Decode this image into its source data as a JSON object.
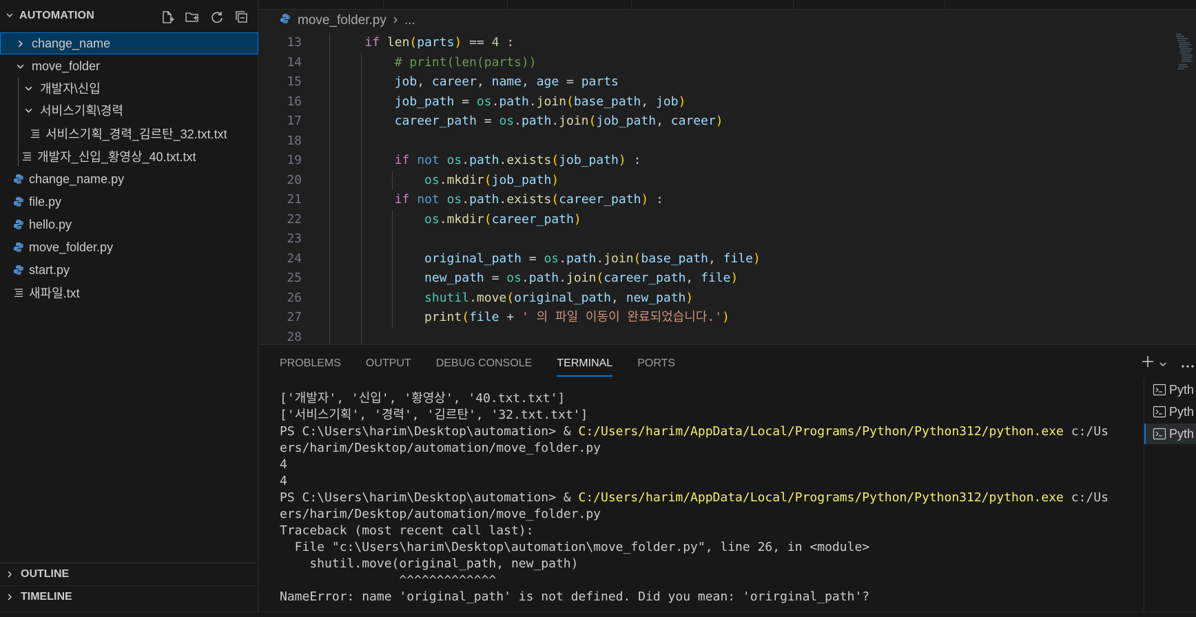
{
  "explorer": {
    "title": "AUTOMATION",
    "actions": [
      "new-file-icon",
      "new-folder-icon",
      "refresh-icon",
      "collapse-all-icon"
    ],
    "items": [
      {
        "label": "change_name",
        "type": "folder",
        "state": "collapsed"
      },
      {
        "label": "move_folder",
        "type": "folder",
        "state": "expanded"
      },
      {
        "label": "개발자\\신입",
        "type": "folder",
        "state": "expanded"
      },
      {
        "label": "서비스기획\\경력",
        "type": "folder",
        "state": "expanded"
      },
      {
        "label": "서비스기획_경력_김르탄_32.txt.txt",
        "type": "text"
      },
      {
        "label": "개발자_신입_황영상_40.txt.txt",
        "type": "text"
      },
      {
        "label": "change_name.py",
        "type": "python"
      },
      {
        "label": "file.py",
        "type": "python"
      },
      {
        "label": "hello.py",
        "type": "python"
      },
      {
        "label": "move_folder.py",
        "type": "python"
      },
      {
        "label": "start.py",
        "type": "python"
      },
      {
        "label": "새파일.txt",
        "type": "text"
      }
    ],
    "outline_label": "OUTLINE",
    "timeline_label": "TIMELINE"
  },
  "editor": {
    "breadcrumb_file": "move_folder.py",
    "breadcrumb_rest": "...",
    "line_numbers": [
      "13",
      "14",
      "15",
      "16",
      "17",
      "18",
      "19",
      "20",
      "21",
      "22",
      "23",
      "24",
      "25",
      "26",
      "27",
      "28"
    ]
  },
  "panel": {
    "tabs": [
      "PROBLEMS",
      "OUTPUT",
      "DEBUG CONSOLE",
      "TERMINAL",
      "PORTS"
    ],
    "active_tab": "TERMINAL",
    "terminal_lines": [
      "['개발자', '신입', '황영상', '40.txt.txt']",
      "['서비스기획', '경력', '김르탄', '32.txt.txt']",
      "PS C:\\Users\\harim\\Desktop\\automation> & ",
      "C:/Users/harim/AppData/Local/Programs/Python/Python312/python.exe",
      " c:/Us",
      "ers/harim/Desktop/automation/move_folder.py",
      "4",
      "4",
      "Traceback (most recent call last):",
      "  File \"c:\\Users\\harim\\Desktop\\automation\\move_folder.py\", line 26, in <module>",
      "    shutil.move(original_path, new_path)",
      "                ^^^^^^^^^^^^^",
      "NameError: name 'original_path' is not defined. Did you mean: 'orirginal_path'?"
    ],
    "terminal_tabs": [
      "Pyth",
      "Pyth",
      "Pyth"
    ]
  }
}
